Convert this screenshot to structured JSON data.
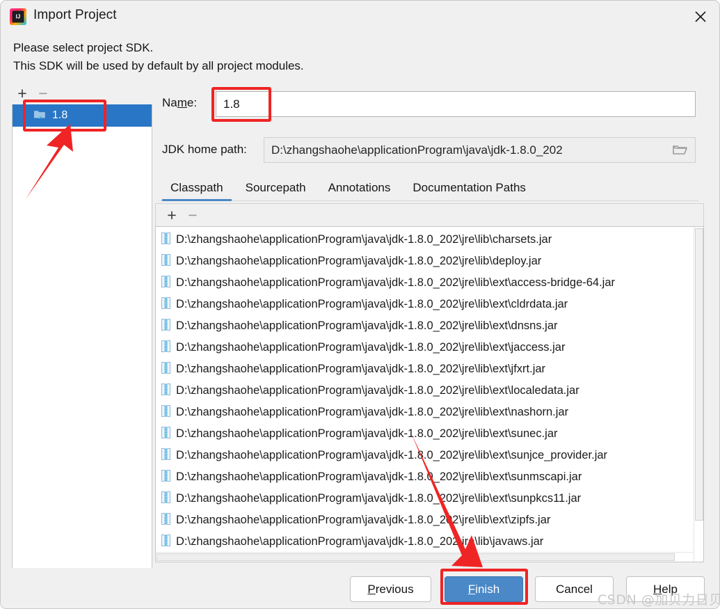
{
  "window": {
    "title": "Import Project",
    "app_icon": "intellij-idea-icon",
    "close_icon": "close-icon"
  },
  "header": {
    "line1": "Please select project SDK.",
    "line2": "This SDK will be used by default by all project modules."
  },
  "sdk_panel": {
    "add_label": "+",
    "remove_label": "−",
    "items": [
      {
        "label": "1.8",
        "icon": "java-sdk-folder-icon",
        "selected": true
      }
    ]
  },
  "name_field": {
    "label": "Na",
    "label_mnemonic": "m",
    "label_rest": "e:",
    "value": "1.8",
    "placeholder": ""
  },
  "jdk_path_field": {
    "label": "JDK home path:",
    "value": "D:\\zhangshaohe\\applicationProgram\\java\\jdk-1.8.0_202",
    "browse_icon": "folder-browse-icon"
  },
  "tabs": [
    {
      "label": "Classpath",
      "active": true
    },
    {
      "label": "Sourcepath",
      "active": false
    },
    {
      "label": "Annotations",
      "active": false
    },
    {
      "label": "Documentation Paths",
      "active": false
    }
  ],
  "classpath_toolbar": {
    "add_label": "+",
    "remove_label": "−"
  },
  "classpath_entries": [
    "D:\\zhangshaohe\\applicationProgram\\java\\jdk-1.8.0_202\\jre\\lib\\charsets.jar",
    "D:\\zhangshaohe\\applicationProgram\\java\\jdk-1.8.0_202\\jre\\lib\\deploy.jar",
    "D:\\zhangshaohe\\applicationProgram\\java\\jdk-1.8.0_202\\jre\\lib\\ext\\access-bridge-64.jar",
    "D:\\zhangshaohe\\applicationProgram\\java\\jdk-1.8.0_202\\jre\\lib\\ext\\cldrdata.jar",
    "D:\\zhangshaohe\\applicationProgram\\java\\jdk-1.8.0_202\\jre\\lib\\ext\\dnsns.jar",
    "D:\\zhangshaohe\\applicationProgram\\java\\jdk-1.8.0_202\\jre\\lib\\ext\\jaccess.jar",
    "D:\\zhangshaohe\\applicationProgram\\java\\jdk-1.8.0_202\\jre\\lib\\ext\\jfxrt.jar",
    "D:\\zhangshaohe\\applicationProgram\\java\\jdk-1.8.0_202\\jre\\lib\\ext\\localedata.jar",
    "D:\\zhangshaohe\\applicationProgram\\java\\jdk-1.8.0_202\\jre\\lib\\ext\\nashorn.jar",
    "D:\\zhangshaohe\\applicationProgram\\java\\jdk-1.8.0_202\\jre\\lib\\ext\\sunec.jar",
    "D:\\zhangshaohe\\applicationProgram\\java\\jdk-1.8.0_202\\jre\\lib\\ext\\sunjce_provider.jar",
    "D:\\zhangshaohe\\applicationProgram\\java\\jdk-1.8.0_202\\jre\\lib\\ext\\sunmscapi.jar",
    "D:\\zhangshaohe\\applicationProgram\\java\\jdk-1.8.0_202\\jre\\lib\\ext\\sunpkcs11.jar",
    "D:\\zhangshaohe\\applicationProgram\\java\\jdk-1.8.0_202\\jre\\lib\\ext\\zipfs.jar",
    "D:\\zhangshaohe\\applicationProgram\\java\\jdk-1.8.0_202\\jre\\lib\\javaws.jar"
  ],
  "footer_buttons": [
    {
      "name": "previous",
      "mnemonic": "P",
      "rest": "revious",
      "primary": false
    },
    {
      "name": "finish",
      "mnemonic": "F",
      "rest": "inish",
      "primary": true
    },
    {
      "name": "cancel",
      "mnemonic": "",
      "rest": "Cancel",
      "primary": false
    },
    {
      "name": "help",
      "mnemonic": "H",
      "rest": "elp",
      "primary": false
    }
  ],
  "annotations": {
    "accent_color": "#ef2424",
    "boxes": [
      "sdk-item-1.8",
      "name-input",
      "finish-button"
    ],
    "arrows": [
      "arrow-to-sdk-item",
      "arrow-to-finish-button"
    ]
  },
  "watermark": {
    "text": "CSDN @加贝力日贝"
  },
  "colors": {
    "selection_blue": "#2a76c6",
    "primary_button": "#4a88c7",
    "dialog_bg": "#f0f0f0",
    "annotation_red": "#ef2424"
  }
}
